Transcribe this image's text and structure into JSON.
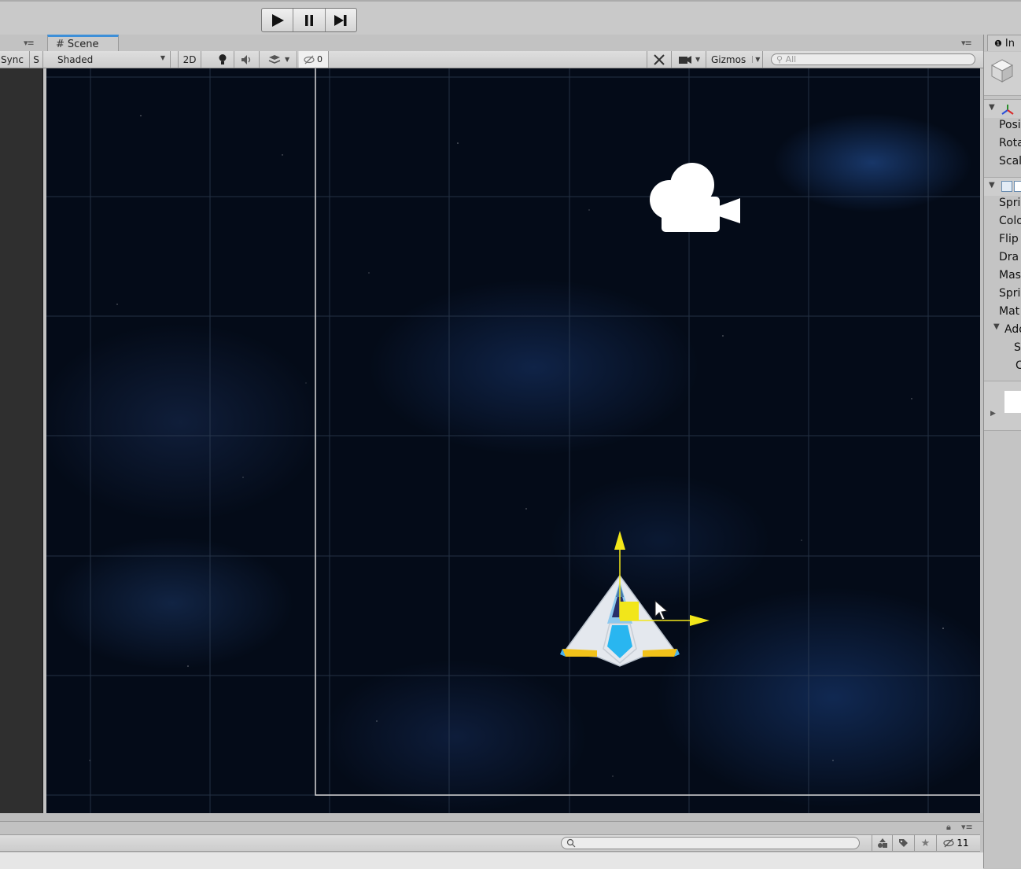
{
  "toolbar": {
    "play_icon": "play-icon",
    "pause_icon": "pause-icon",
    "step_icon": "step-icon"
  },
  "scene_tab": {
    "label": "Scene",
    "icon": "grid-hash-icon"
  },
  "scene_toolbar": {
    "sync_label": "Sync",
    "s_label": "S",
    "shading_mode": "Shaded",
    "mode_2d": "2D",
    "hidden_count": "0",
    "gizmos_label": "Gizmos",
    "search_placeholder": "All"
  },
  "inspector": {
    "tab_label": "In",
    "transform_rows": [
      "Posi",
      "Rota",
      "Scal"
    ],
    "sprite_rows": [
      "Spri",
      "Colo",
      "Flip",
      "Dra",
      "Mas",
      "Spri",
      "Mat"
    ],
    "additional_label": "Ado",
    "additional_rows": [
      "S",
      "C"
    ]
  },
  "bottom_bar": {
    "layer_count": "11"
  },
  "colors": {
    "accent_tab": "#3d8fd8",
    "gizmo_yellow": "#f2e61a",
    "scene_background": "#040b18",
    "grid_line": "#3a4a60"
  }
}
